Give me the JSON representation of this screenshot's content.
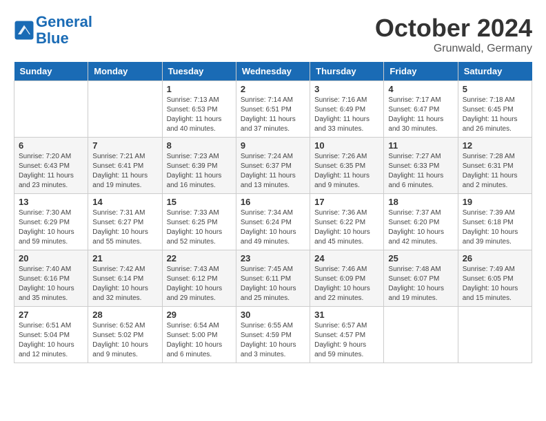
{
  "header": {
    "logo": "GeneralBlue",
    "month": "October 2024",
    "location": "Grunwald, Germany"
  },
  "days_of_week": [
    "Sunday",
    "Monday",
    "Tuesday",
    "Wednesday",
    "Thursday",
    "Friday",
    "Saturday"
  ],
  "weeks": [
    [
      {
        "num": "",
        "info": ""
      },
      {
        "num": "",
        "info": ""
      },
      {
        "num": "1",
        "info": "Sunrise: 7:13 AM\nSunset: 6:53 PM\nDaylight: 11 hours\nand 40 minutes."
      },
      {
        "num": "2",
        "info": "Sunrise: 7:14 AM\nSunset: 6:51 PM\nDaylight: 11 hours\nand 37 minutes."
      },
      {
        "num": "3",
        "info": "Sunrise: 7:16 AM\nSunset: 6:49 PM\nDaylight: 11 hours\nand 33 minutes."
      },
      {
        "num": "4",
        "info": "Sunrise: 7:17 AM\nSunset: 6:47 PM\nDaylight: 11 hours\nand 30 minutes."
      },
      {
        "num": "5",
        "info": "Sunrise: 7:18 AM\nSunset: 6:45 PM\nDaylight: 11 hours\nand 26 minutes."
      }
    ],
    [
      {
        "num": "6",
        "info": "Sunrise: 7:20 AM\nSunset: 6:43 PM\nDaylight: 11 hours\nand 23 minutes."
      },
      {
        "num": "7",
        "info": "Sunrise: 7:21 AM\nSunset: 6:41 PM\nDaylight: 11 hours\nand 19 minutes."
      },
      {
        "num": "8",
        "info": "Sunrise: 7:23 AM\nSunset: 6:39 PM\nDaylight: 11 hours\nand 16 minutes."
      },
      {
        "num": "9",
        "info": "Sunrise: 7:24 AM\nSunset: 6:37 PM\nDaylight: 11 hours\nand 13 minutes."
      },
      {
        "num": "10",
        "info": "Sunrise: 7:26 AM\nSunset: 6:35 PM\nDaylight: 11 hours\nand 9 minutes."
      },
      {
        "num": "11",
        "info": "Sunrise: 7:27 AM\nSunset: 6:33 PM\nDaylight: 11 hours\nand 6 minutes."
      },
      {
        "num": "12",
        "info": "Sunrise: 7:28 AM\nSunset: 6:31 PM\nDaylight: 11 hours\nand 2 minutes."
      }
    ],
    [
      {
        "num": "13",
        "info": "Sunrise: 7:30 AM\nSunset: 6:29 PM\nDaylight: 10 hours\nand 59 minutes."
      },
      {
        "num": "14",
        "info": "Sunrise: 7:31 AM\nSunset: 6:27 PM\nDaylight: 10 hours\nand 55 minutes."
      },
      {
        "num": "15",
        "info": "Sunrise: 7:33 AM\nSunset: 6:25 PM\nDaylight: 10 hours\nand 52 minutes."
      },
      {
        "num": "16",
        "info": "Sunrise: 7:34 AM\nSunset: 6:24 PM\nDaylight: 10 hours\nand 49 minutes."
      },
      {
        "num": "17",
        "info": "Sunrise: 7:36 AM\nSunset: 6:22 PM\nDaylight: 10 hours\nand 45 minutes."
      },
      {
        "num": "18",
        "info": "Sunrise: 7:37 AM\nSunset: 6:20 PM\nDaylight: 10 hours\nand 42 minutes."
      },
      {
        "num": "19",
        "info": "Sunrise: 7:39 AM\nSunset: 6:18 PM\nDaylight: 10 hours\nand 39 minutes."
      }
    ],
    [
      {
        "num": "20",
        "info": "Sunrise: 7:40 AM\nSunset: 6:16 PM\nDaylight: 10 hours\nand 35 minutes."
      },
      {
        "num": "21",
        "info": "Sunrise: 7:42 AM\nSunset: 6:14 PM\nDaylight: 10 hours\nand 32 minutes."
      },
      {
        "num": "22",
        "info": "Sunrise: 7:43 AM\nSunset: 6:12 PM\nDaylight: 10 hours\nand 29 minutes."
      },
      {
        "num": "23",
        "info": "Sunrise: 7:45 AM\nSunset: 6:11 PM\nDaylight: 10 hours\nand 25 minutes."
      },
      {
        "num": "24",
        "info": "Sunrise: 7:46 AM\nSunset: 6:09 PM\nDaylight: 10 hours\nand 22 minutes."
      },
      {
        "num": "25",
        "info": "Sunrise: 7:48 AM\nSunset: 6:07 PM\nDaylight: 10 hours\nand 19 minutes."
      },
      {
        "num": "26",
        "info": "Sunrise: 7:49 AM\nSunset: 6:05 PM\nDaylight: 10 hours\nand 15 minutes."
      }
    ],
    [
      {
        "num": "27",
        "info": "Sunrise: 6:51 AM\nSunset: 5:04 PM\nDaylight: 10 hours\nand 12 minutes."
      },
      {
        "num": "28",
        "info": "Sunrise: 6:52 AM\nSunset: 5:02 PM\nDaylight: 10 hours\nand 9 minutes."
      },
      {
        "num": "29",
        "info": "Sunrise: 6:54 AM\nSunset: 5:00 PM\nDaylight: 10 hours\nand 6 minutes."
      },
      {
        "num": "30",
        "info": "Sunrise: 6:55 AM\nSunset: 4:59 PM\nDaylight: 10 hours\nand 3 minutes."
      },
      {
        "num": "31",
        "info": "Sunrise: 6:57 AM\nSunset: 4:57 PM\nDaylight: 9 hours\nand 59 minutes."
      },
      {
        "num": "",
        "info": ""
      },
      {
        "num": "",
        "info": ""
      }
    ]
  ]
}
